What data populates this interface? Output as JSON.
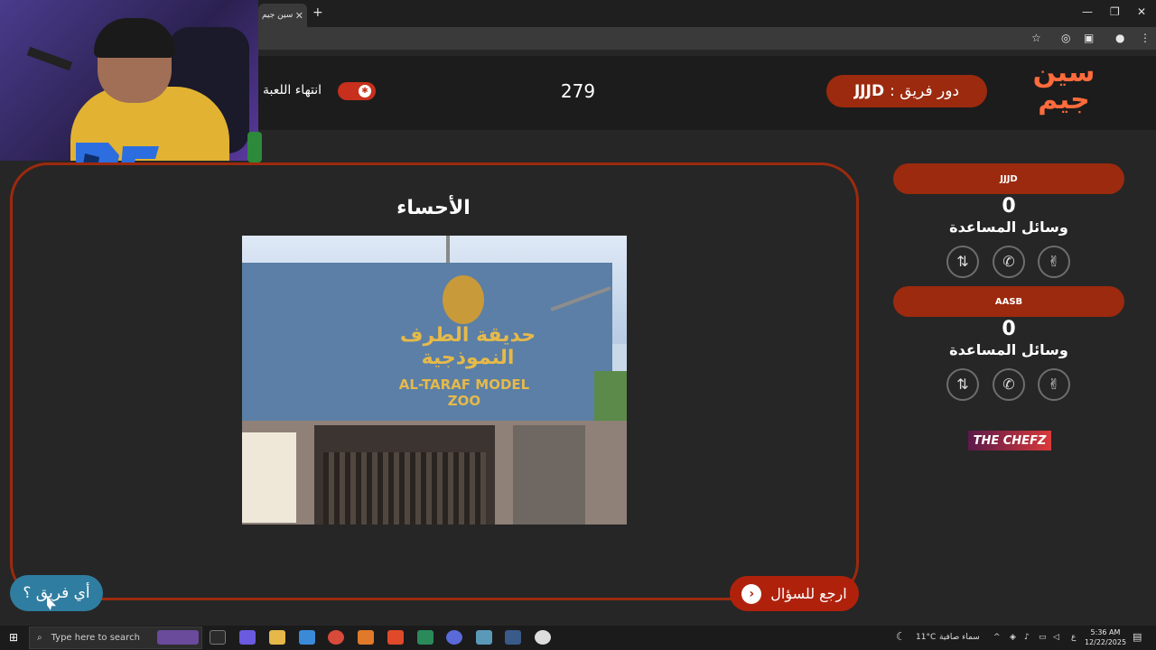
{
  "browser": {
    "tab_title": "سين جيم",
    "tab_close": "✕",
    "new_tab": "+",
    "window_controls": {
      "minimize": "—",
      "restore": "❐",
      "close": "✕"
    }
  },
  "header": {
    "end_game_label": "انتهاء اللعبة",
    "timer": "279",
    "turn_prefix": "دور فريق :",
    "turn_team": "JJJD",
    "logo_line1": "سين",
    "logo_line2": "جيم"
  },
  "question": {
    "title": "الأحساء",
    "image": {
      "sign_arabic": "حديقة الطرف النموذجية",
      "sign_english": "AL-TARAF MODEL ZOO"
    }
  },
  "buttons": {
    "which_team": "أي فريق ؟",
    "back_to_question": "ارجع للسؤال"
  },
  "teams": [
    {
      "name": "JJJD",
      "score": "0",
      "aids_label": "وسائل المساعدة",
      "aids": [
        "reverse-icon",
        "phone-icon",
        "peace-hand-icon"
      ]
    },
    {
      "name": "AASB",
      "score": "0",
      "aids_label": "وسائل المساعدة",
      "aids": [
        "reverse-icon",
        "phone-icon",
        "peace-hand-icon"
      ]
    }
  ],
  "sponsor": {
    "text": "THE CHEFZ"
  },
  "taskbar": {
    "search_placeholder": "Type here to search",
    "weather_temp": "11°C",
    "weather_desc": "سماء صافية",
    "lang": "ع",
    "time": "5:36 AM",
    "date": "12/22/2025"
  },
  "colors": {
    "accent": "#9c2a0e",
    "toggle": "#c7301c",
    "which_team_button": "#2f7da0",
    "back_button": "#b0210c",
    "logo": "#ff6b3c"
  }
}
